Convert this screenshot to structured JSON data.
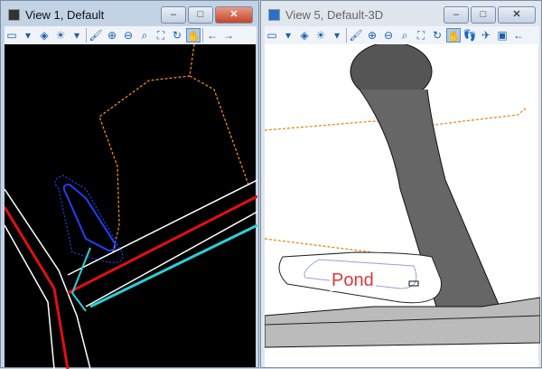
{
  "view1": {
    "title": "View 1, Default",
    "controls": {
      "minimize": "–",
      "maximize": "□",
      "close": "✕"
    },
    "tools": [
      {
        "icon": "view-attributes-icon",
        "glyph": "▭"
      },
      {
        "icon": "dropdown-icon",
        "glyph": "▾"
      },
      {
        "icon": "display-style-icon",
        "glyph": "◈"
      },
      {
        "icon": "lighting-icon",
        "glyph": "☀"
      },
      {
        "icon": "dropdown-icon",
        "glyph": "▾"
      },
      {
        "icon": "update-view-icon",
        "glyph": "🖌"
      },
      {
        "icon": "zoom-in-icon",
        "glyph": "⊕"
      },
      {
        "icon": "zoom-out-icon",
        "glyph": "⊖"
      },
      {
        "icon": "window-area-icon",
        "glyph": "⌕"
      },
      {
        "icon": "fit-view-icon",
        "glyph": "⛶"
      },
      {
        "icon": "rotate-view-icon",
        "glyph": "↻"
      },
      {
        "icon": "pan-view-icon",
        "glyph": "✋"
      },
      {
        "icon": "previous-view-icon",
        "glyph": "←"
      },
      {
        "icon": "next-view-icon",
        "glyph": "→"
      }
    ]
  },
  "view2": {
    "title": "View 5, Default-3D",
    "controls": {
      "minimize": "–",
      "maximize": "□",
      "close": "✕"
    },
    "tools": [
      {
        "icon": "view-attributes-icon",
        "glyph": "▭"
      },
      {
        "icon": "dropdown-icon",
        "glyph": "▾"
      },
      {
        "icon": "display-style-icon",
        "glyph": "◈"
      },
      {
        "icon": "lighting-icon",
        "glyph": "☀"
      },
      {
        "icon": "dropdown-icon",
        "glyph": "▾"
      },
      {
        "icon": "update-view-icon",
        "glyph": "🖌"
      },
      {
        "icon": "zoom-in-icon",
        "glyph": "⊕"
      },
      {
        "icon": "zoom-out-icon",
        "glyph": "⊖"
      },
      {
        "icon": "window-area-icon",
        "glyph": "⌕"
      },
      {
        "icon": "fit-view-icon",
        "glyph": "⛶"
      },
      {
        "icon": "rotate-view-icon",
        "glyph": "↻"
      },
      {
        "icon": "pan-view-icon",
        "glyph": "✋"
      },
      {
        "icon": "walk-icon",
        "glyph": "👣"
      },
      {
        "icon": "fly-icon",
        "glyph": "✈"
      },
      {
        "icon": "camera-icon",
        "glyph": "▣"
      },
      {
        "icon": "previous-view-icon",
        "glyph": "←"
      }
    ],
    "annotation": "Pond"
  }
}
